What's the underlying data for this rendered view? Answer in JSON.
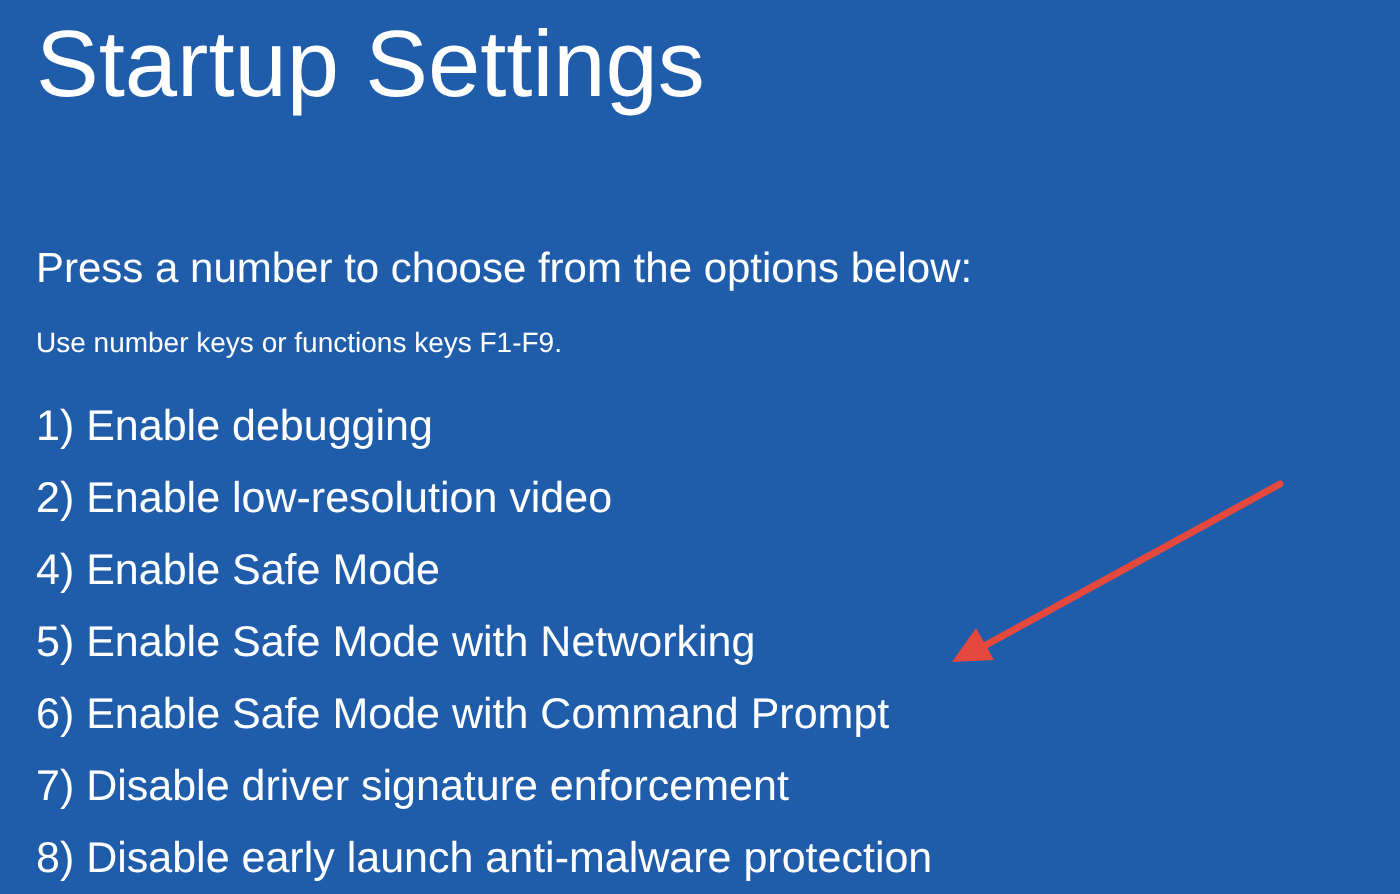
{
  "title": "Startup Settings",
  "instruction": "Press a number to choose from the options below:",
  "hint": "Use number keys or functions keys F1-F9.",
  "options": [
    {
      "label": "1) Enable debugging"
    },
    {
      "label": "2) Enable low-resolution video"
    },
    {
      "label": "4) Enable Safe Mode"
    },
    {
      "label": "5) Enable Safe Mode with Networking"
    },
    {
      "label": "6) Enable Safe Mode with Command Prompt"
    },
    {
      "label": "7) Disable driver signature enforcement"
    },
    {
      "label": "8) Disable early launch anti-malware protection"
    }
  ]
}
